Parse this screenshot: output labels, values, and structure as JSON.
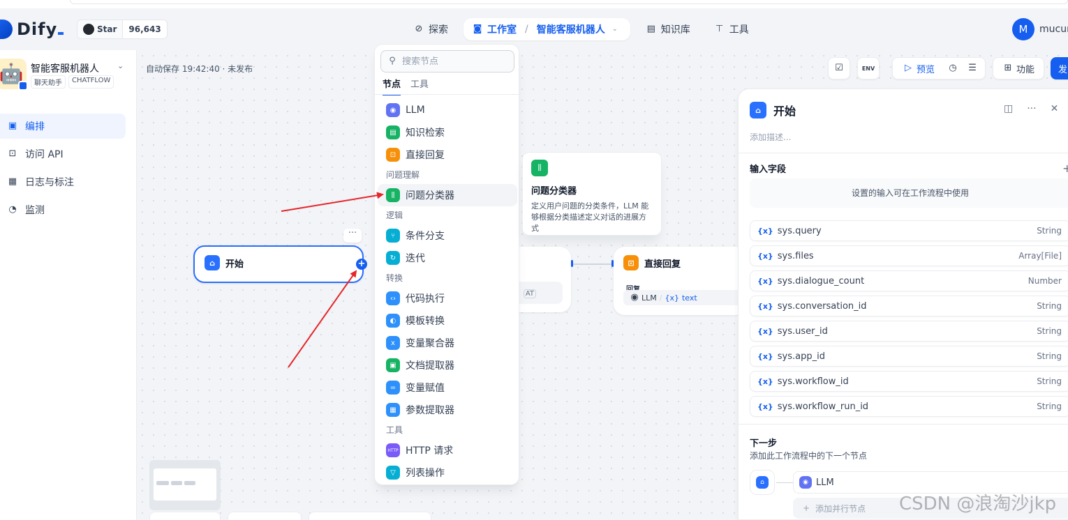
{
  "header": {
    "brand": "Dify",
    "github": {
      "star_label": "Star",
      "star_count": "96,643"
    },
    "nav": {
      "explore": "探索",
      "studio": "工作室",
      "separator": "/",
      "current_app": "智能客服机器人",
      "knowledge": "知识库",
      "tools": "工具"
    },
    "user": {
      "avatar_letter": "M",
      "name": "mucun"
    }
  },
  "sidebar": {
    "app_name": "智能客服机器人",
    "app_tags": [
      "聊天助手",
      "CHATFLOW"
    ],
    "items": [
      {
        "label": "编排",
        "icon": "layout-icon",
        "active": true
      },
      {
        "label": "访问 API",
        "icon": "terminal-icon",
        "active": false
      },
      {
        "label": "日志与标注",
        "icon": "document-icon",
        "active": false
      },
      {
        "label": "监测",
        "icon": "gauge-icon",
        "active": false
      }
    ]
  },
  "canvas": {
    "autosave": "自动保存 19:42:40 · 未发布",
    "toolbar": {
      "env": "ENV",
      "preview": "预览",
      "features": "功能",
      "publish": "发"
    },
    "nodes": {
      "start": {
        "title": "开始"
      },
      "reply": {
        "title": "直接回复",
        "field_label": "回复",
        "source": "LLM",
        "variable": "text"
      },
      "behind_tag": "AT"
    }
  },
  "node_selector": {
    "search_placeholder": "搜索节点",
    "tabs": [
      "节点",
      "工具"
    ],
    "groups": [
      {
        "title": "",
        "items": [
          {
            "label": "LLM",
            "icon": "llm-icon",
            "color": "#6172f3"
          },
          {
            "label": "知识检索",
            "icon": "book-icon",
            "color": "#16b364"
          },
          {
            "label": "直接回复",
            "icon": "reply-icon",
            "color": "#f79009"
          }
        ]
      },
      {
        "title": "问题理解",
        "items": [
          {
            "label": "问题分类器",
            "icon": "classifier-icon",
            "color": "#16b364",
            "hover": true
          }
        ]
      },
      {
        "title": "逻辑",
        "items": [
          {
            "label": "条件分支",
            "icon": "branch-icon",
            "color": "#06aed4"
          },
          {
            "label": "迭代",
            "icon": "loop-icon",
            "color": "#06aed4"
          }
        ]
      },
      {
        "title": "转换",
        "items": [
          {
            "label": "代码执行",
            "icon": "code-icon",
            "color": "#2e90fa"
          },
          {
            "label": "模板转换",
            "icon": "template-icon",
            "color": "#2e90fa"
          },
          {
            "label": "变量聚合器",
            "icon": "variable-icon",
            "color": "#2e90fa"
          },
          {
            "label": "文档提取器",
            "icon": "doc-extract-icon",
            "color": "#16b364"
          },
          {
            "label": "变量赋值",
            "icon": "assign-icon",
            "color": "#2e90fa"
          },
          {
            "label": "参数提取器",
            "icon": "param-icon",
            "color": "#2e90fa"
          }
        ]
      },
      {
        "title": "工具",
        "items": [
          {
            "label": "HTTP 请求",
            "icon": "http-icon",
            "color": "#7a5af8"
          },
          {
            "label": "列表操作",
            "icon": "filter-icon",
            "color": "#06aed4"
          }
        ]
      }
    ]
  },
  "tooltip": {
    "title": "问题分类器",
    "description": "定义用户问题的分类条件，LLM 能够根据分类描述定义对话的进展方式"
  },
  "panel": {
    "title": "开始",
    "description_placeholder": "添加描述...",
    "input_fields_label": "输入字段",
    "input_hint": "设置的输入可在工作流程中使用",
    "variables": [
      {
        "name": "sys.query",
        "type": "String"
      },
      {
        "name": "sys.files",
        "type": "Array[File]"
      },
      {
        "name": "sys.dialogue_count",
        "type": "Number"
      },
      {
        "name": "sys.conversation_id",
        "type": "String"
      },
      {
        "name": "sys.user_id",
        "type": "String"
      },
      {
        "name": "sys.app_id",
        "type": "String"
      },
      {
        "name": "sys.workflow_id",
        "type": "String"
      },
      {
        "name": "sys.workflow_run_id",
        "type": "String"
      }
    ],
    "next_step_label": "下一步",
    "next_step_desc": "添加此工作流程中的下一个节点",
    "next_node": "LLM",
    "add_parallel": "添加并行节点"
  },
  "watermark": "CSDN @浪淘沙jkp",
  "colors": {
    "accent": "#155eef",
    "annotation_arrow": "#e5262b"
  }
}
